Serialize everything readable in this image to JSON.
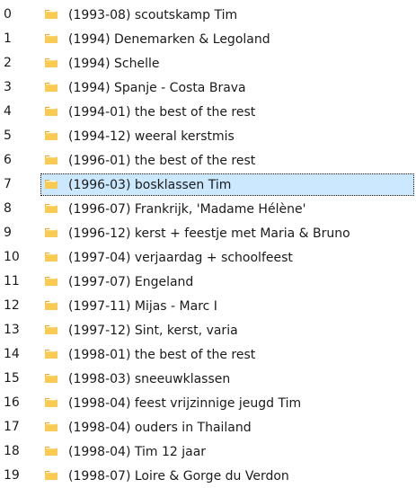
{
  "colors": {
    "selection_bg": "#cce8ff",
    "folder_body": "#F9CB52",
    "folder_dark": "#E6A73A",
    "folder_paper": "#FFFFFF",
    "text": "#1a1a1a"
  },
  "icons": {
    "folder": "folder-icon"
  },
  "selected_index": 7,
  "rows": [
    {
      "index": "0",
      "name": "(1993-08) scoutskamp Tim"
    },
    {
      "index": "1",
      "name": "(1994) Denemarken & Legoland"
    },
    {
      "index": "2",
      "name": "(1994) Schelle"
    },
    {
      "index": "3",
      "name": "(1994) Spanje - Costa Brava"
    },
    {
      "index": "4",
      "name": "(1994-01) the best of the rest"
    },
    {
      "index": "5",
      "name": "(1994-12) weeral kerstmis"
    },
    {
      "index": "6",
      "name": "(1996-01) the best of the rest"
    },
    {
      "index": "7",
      "name": "(1996-03) bosklassen Tim"
    },
    {
      "index": "8",
      "name": "(1996-07) Frankrijk, 'Madame Hélène'"
    },
    {
      "index": "9",
      "name": "(1996-12) kerst + feestje met Maria & Bruno"
    },
    {
      "index": "10",
      "name": "(1997-04) verjaardag + schoolfeest"
    },
    {
      "index": "11",
      "name": "(1997-07) Engeland"
    },
    {
      "index": "12",
      "name": "(1997-11) Mijas - Marc I"
    },
    {
      "index": "13",
      "name": "(1997-12) Sint, kerst, varia"
    },
    {
      "index": "14",
      "name": "(1998-01) the best of the rest"
    },
    {
      "index": "15",
      "name": "(1998-03) sneeuwklassen"
    },
    {
      "index": "16",
      "name": "(1998-04) feest vrijzinnige jeugd Tim"
    },
    {
      "index": "17",
      "name": "(1998-04) ouders in Thailand"
    },
    {
      "index": "18",
      "name": "(1998-04) Tim 12 jaar"
    },
    {
      "index": "19",
      "name": "(1998-07) Loire & Gorge du Verdon"
    }
  ]
}
